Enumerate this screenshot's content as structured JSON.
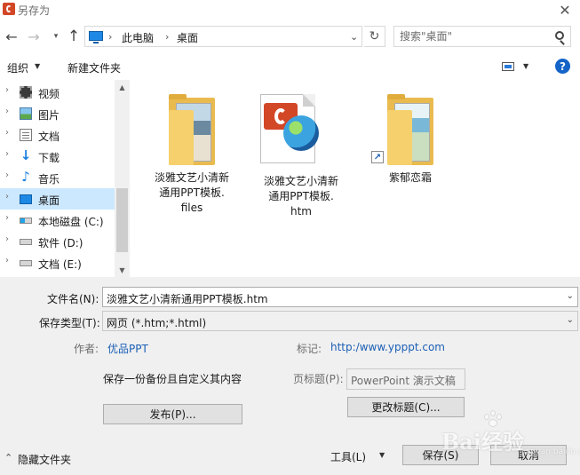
{
  "window": {
    "title": "另存为",
    "close_glyph": "✕"
  },
  "nav": {
    "back_glyph": "←",
    "forward_glyph": "→",
    "recent_glyph": "▾",
    "up_glyph": "↑",
    "breadcrumb": [
      "此电脑",
      "桌面"
    ],
    "separator": "›",
    "dropdown_glyph": "⌄",
    "refresh_glyph": "↻",
    "search_placeholder": "搜索\"桌面\""
  },
  "toolbar": {
    "organize_label": "组织",
    "dropdown_glyph": "▼",
    "new_folder_label": "新建文件夹",
    "help_glyph": "?"
  },
  "sidebar": {
    "chevron": "›",
    "items": [
      {
        "label": "视频",
        "icon": "video-icon"
      },
      {
        "label": "图片",
        "icon": "pictures-icon"
      },
      {
        "label": "文档",
        "icon": "documents-icon"
      },
      {
        "label": "下载",
        "icon": "download-icon",
        "glyph": "↓"
      },
      {
        "label": "音乐",
        "icon": "music-icon",
        "glyph": "♪"
      },
      {
        "label": "桌面",
        "icon": "desktop-icon",
        "selected": true
      },
      {
        "label": "本地磁盘 (C:)",
        "icon": "drive-c-icon"
      },
      {
        "label": "软件 (D:)",
        "icon": "drive-d-icon"
      },
      {
        "label": "文档 (E:)",
        "icon": "drive-e-icon"
      }
    ],
    "scroll_up_glyph": "▲",
    "scroll_down_glyph": "▼"
  },
  "files": [
    {
      "name_lines": [
        "淡雅文艺小清新",
        "通用PPT模板.",
        "files"
      ],
      "icon": "folder-icon"
    },
    {
      "name_lines": [
        "淡雅文艺小清新",
        "通用PPT模板.",
        "htm"
      ],
      "icon": "ppt-html-file-icon"
    },
    {
      "name_lines": [
        "紫郁恋霜"
      ],
      "icon": "folder-shortcut-icon",
      "shortcut_glyph": "↗"
    }
  ],
  "form": {
    "filename_label": "文件名(N):",
    "filename_value": "淡雅文艺小清新通用PPT模板.htm",
    "filetype_label": "保存类型(T):",
    "filetype_value": "网页 (*.htm;*.html)",
    "combo_arrow": "⌄",
    "author_label": "作者:",
    "author_value": "优品PPT",
    "tags_label": "标记:",
    "tags_value": "http:/www.ypppt.com",
    "backup_label": "保存一份备份且自定义其内容",
    "page_title_label": "页标题(P):",
    "page_title_value": "PowerPoint 演示文稿",
    "publish_button": "发布(P)...",
    "change_title_button": "更改标题(C)..."
  },
  "footer": {
    "hide_folders_glyph": "⌃",
    "hide_folders_label": "隐藏文件夹",
    "tools_label": "工具(L)",
    "tools_arrow": "▼",
    "save_button": "保存(S)",
    "cancel_button": "取消"
  },
  "watermark": {
    "text": "Bai经验",
    "sub": "jingyan.baidu.com"
  }
}
